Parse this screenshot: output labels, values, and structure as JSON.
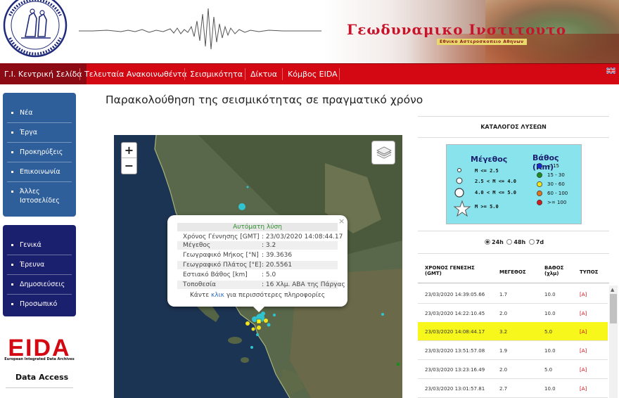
{
  "banner": {
    "institute_title": "Γεωδυναμικο Ινστιτουτο",
    "institute_subtitle": "Εθνικο Αστεροσκοπειο Αθηνων",
    "seal_text": "ΕΘΝΙΚΟΝ ΑΣΤΕΡΟΣΚΟΠΕΙΟΝ ΑΘΗΝΩΝ · NATIONAL OBSERVATORY ATHENS"
  },
  "nav": {
    "items": [
      {
        "label": "Γ.Ι. Κεντρική Σελίδα",
        "active": true
      },
      {
        "label": "Τελευταία Ανακοινωθέντα",
        "active": false
      },
      {
        "label": "Σεισμικότητα",
        "active": false
      },
      {
        "label": "Δίκτυα",
        "active": false
      },
      {
        "label": "Κόμβος EIDA",
        "active": false
      }
    ],
    "flag_icon": "uk-flag-icon"
  },
  "sidebar": {
    "group1": [
      "Νέα",
      "Έργα",
      "Προκηρύξεις",
      "Επικοινωνία",
      "Άλλες Ιστοσελίδες"
    ],
    "group2": [
      "Γενικά",
      "Έρευνα",
      "Δημοσιεύσεις",
      "Προσωπικό"
    ],
    "eida_logo": "EIDA",
    "eida_caption": "European Integrated Data Archives",
    "data_access": "Data Access"
  },
  "main": {
    "title": "Παρακολούθηση της σεισμικότητας σε πραγματικό χρόνο"
  },
  "map": {
    "zoom_in": "+",
    "zoom_out": "−",
    "layers_icon": "layers-icon",
    "popup": {
      "heading": "Αυτόματη λύση",
      "close": "×",
      "rows": [
        {
          "k": "Χρόνος Γέννησης [GMT]",
          "v": ": 23/03/2020 14:08:44.17"
        },
        {
          "k": "Μέγεθος",
          "v": ": 3.2"
        },
        {
          "k": "Γεωγραφικό Μήκος [°N]",
          "v": ": 39.3636"
        },
        {
          "k": "Γεωγραφικό Πλάτος [°E]",
          "v": ": 20.5561"
        },
        {
          "k": "Εστιακό Βάθος [km]",
          "v": ": 5.0"
        },
        {
          "k": "Τοποθεσία",
          "v": ": 16 Χλμ. ΑΒΑ της Πάργας"
        }
      ],
      "more_prefix": "Κάντε ",
      "more_link": "κλικ",
      "more_suffix": " για περισσότερες πληροφορίες"
    }
  },
  "catalog": {
    "title": "ΚΑΤΑΛΟΓΟΣ ΛΥΣΕΩΝ",
    "legend": {
      "mag_title": "Μέγεθος",
      "mag_items": [
        "M <= 2.5",
        "2.5 < M <= 4.0",
        "4.0 < M <= 5.0",
        "M >= 5.0"
      ],
      "depth_title": "Βάθος (Km)",
      "depth_items": [
        {
          "label": "< 15",
          "color": "#1a2bd0"
        },
        {
          "label": "15 - 30",
          "color": "#1f8a1f"
        },
        {
          "label": "30 - 60",
          "color": "#f2e21b"
        },
        {
          "label": "60 - 100",
          "color": "#e0731b"
        },
        {
          "label": ">= 100",
          "color": "#d41b1b"
        }
      ]
    },
    "ranges": [
      {
        "label": "24h",
        "selected": true
      },
      {
        "label": "48h",
        "selected": false
      },
      {
        "label": "7d",
        "selected": false
      }
    ],
    "headers": {
      "time": "ΧΡΟΝΟΣ ΓΕΝΕΣΗΣ",
      "time_sub": "(GMT)",
      "mag": "ΜΕΓΕΘΟΣ",
      "depth": "ΒΑΘΟΣ",
      "depth_sub": "(χλμ)",
      "type": "ΤΥΠΟΣ"
    },
    "rows": [
      {
        "time": "23/03/2020 14:39:05.66",
        "mag": "1.7",
        "depth": "10.0",
        "type": "[A]",
        "highlight": false
      },
      {
        "time": "23/03/2020 14:22:10.45",
        "mag": "2.0",
        "depth": "10.0",
        "type": "[A]",
        "highlight": false
      },
      {
        "time": "23/03/2020 14:08:44.17",
        "mag": "3.2",
        "depth": "5.0",
        "type": "[A]",
        "highlight": true
      },
      {
        "time": "23/03/2020 13:51:57.08",
        "mag": "1.9",
        "depth": "10.0",
        "type": "[A]",
        "highlight": false
      },
      {
        "time": "23/03/2020 13:23:16.49",
        "mag": "2.0",
        "depth": "5.0",
        "type": "[A]",
        "highlight": false
      },
      {
        "time": "23/03/2020 13:01:57.81",
        "mag": "2.7",
        "depth": "10.0",
        "type": "[A]",
        "highlight": false
      }
    ]
  }
}
